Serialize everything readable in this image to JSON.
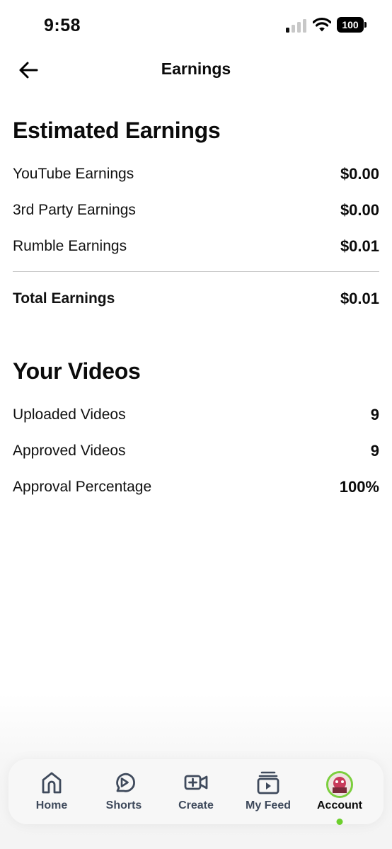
{
  "status_bar": {
    "time": "9:58",
    "battery": "100"
  },
  "header": {
    "title": "Earnings"
  },
  "earnings": {
    "title": "Estimated Earnings",
    "rows": [
      {
        "label": "YouTube Earnings",
        "value": "$0.00"
      },
      {
        "label": "3rd Party Earnings",
        "value": "$0.00"
      },
      {
        "label": "Rumble Earnings",
        "value": "$0.01"
      }
    ],
    "total": {
      "label": "Total Earnings",
      "value": "$0.01"
    }
  },
  "videos": {
    "title": "Your Videos",
    "rows": [
      {
        "label": "Uploaded Videos",
        "value": "9"
      },
      {
        "label": "Approved Videos",
        "value": "9"
      },
      {
        "label": "Approval Percentage",
        "value": "100%"
      }
    ]
  },
  "nav": {
    "items": [
      {
        "label": "Home",
        "icon": "home-icon"
      },
      {
        "label": "Shorts",
        "icon": "shorts-icon"
      },
      {
        "label": "Create",
        "icon": "create-video-icon"
      },
      {
        "label": "My Feed",
        "icon": "feed-icon"
      },
      {
        "label": "Account",
        "icon": "avatar"
      }
    ],
    "active_index": 4,
    "icon_color": "#3f4a5c",
    "active_dot_color": "#6ccf2c"
  }
}
